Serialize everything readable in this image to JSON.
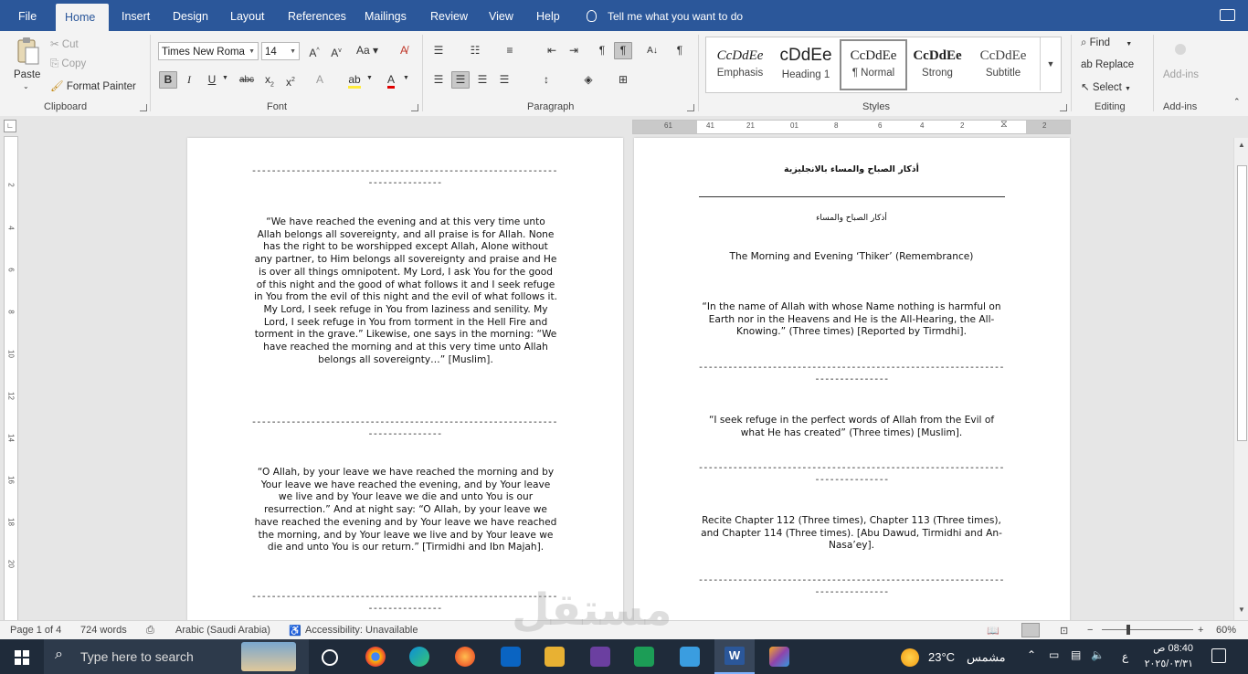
{
  "tabs": [
    "File",
    "Home",
    "Insert",
    "Design",
    "Layout",
    "References",
    "Mailings",
    "Review",
    "View",
    "Help"
  ],
  "active_tab": "Home",
  "tell_me": "Tell me what you want to do",
  "clipboard": {
    "paste": "Paste",
    "cut": "Cut",
    "copy": "Copy",
    "format_painter": "Format Painter",
    "label": "Clipboard"
  },
  "font": {
    "name": "Times New Roma",
    "size": "14",
    "label": "Font"
  },
  "paragraph": {
    "label": "Paragraph"
  },
  "styles": {
    "label": "Styles",
    "items": [
      {
        "sample": "CcDdEe",
        "name": "Emphasis"
      },
      {
        "sample": "cDdEe",
        "name": "Heading 1"
      },
      {
        "sample": "CcDdEe",
        "name": "¶ Normal"
      },
      {
        "sample": "CcDdEe",
        "name": "Strong"
      },
      {
        "sample": "CcDdEe",
        "name": "Subtitle"
      }
    ]
  },
  "editing": {
    "find": "Find",
    "replace": "Replace",
    "select": "Select",
    "label": "Editing"
  },
  "addins": {
    "button": "Add-ins",
    "label": "Add-ins"
  },
  "ruler_h": [
    "61",
    "41",
    "21",
    "01",
    "8",
    "6",
    "4",
    "2",
    "2"
  ],
  "ruler_v": [
    "2",
    "4",
    "6",
    "8",
    "10",
    "12",
    "14",
    "16",
    "18",
    "20"
  ],
  "page_left": {
    "sep1a": "------------------------------------------------------------------------------",
    "sep1b": "---------------",
    "para1": "“We have reached the evening and at this very time unto Allah belongs all sovereignty, and all praise is for Allah. None has the right to be worshipped except Allah, Alone without any partner, to Him belongs all sovereignty and praise and He is over all things omnipotent. My Lord, I ask You for the good of this night and the good of what follows it and I seek refuge in You from the evil of this night and the evil of what follows it. My Lord, I seek refuge in You from laziness and senility. My Lord, I seek refuge in You from torment in the Hell Fire and torment in the grave.” Likewise, one says in the morning: “We have reached the morning and at this very time unto Allah belongs all sovereignty…” [Muslim].",
    "sep2a": "------------------------------------------------------------------------------",
    "sep2b": "---------------",
    "para2": "“O Allah, by your leave we have reached the morning and by Your leave we have reached the evening, and by Your leave we live and by Your leave we die and unto You is our resurrection.” And at night say: “O Allah, by your leave we have reached the evening and by Your leave we have reached the morning, and by Your leave we live and by Your leave we die and unto You is our return.” [Tirmidhi and Ibn Majah].",
    "sep3a": "------------------------------------------------------------------------------",
    "sep3b": "---------------"
  },
  "page_right": {
    "arabic_title": "أذكار الصباح والمساء بالانجليزية",
    "arabic_sub": "أذكار الصباح والمساء",
    "title": "The Morning and Evening ‘Thiker’ (Remembrance)",
    "para1": "“In the name of Allah with whose Name nothing is harmful on Earth nor in the Heavens and He is the All-Hearing, the All-Knowing.” (Three times) [Reported by Tirmdhi].",
    "sep1a": "------------------------------------------------------------------------------",
    "sep1b": "---------------",
    "para2": "“I seek refuge in the perfect words of Allah from the Evil of what He has created” (Three times) [Muslim].",
    "sep2a": "------------------------------------------------------------------------------",
    "sep2b": "---------------",
    "para3": "Recite Chapter 112 (Three times), Chapter 113 (Three times), and Chapter 114 (Three times). [Abu Dawud, Tirmidhi and An-Nasa’ey].",
    "sep3a": "------------------------------------------------------------------------------",
    "sep3b": "---------------"
  },
  "status": {
    "page": "Page 1 of 4",
    "words": "724 words",
    "language": "Arabic (Saudi Arabia)",
    "accessibility": "Accessibility: Unavailable",
    "zoom": "60%"
  },
  "taskbar": {
    "search_placeholder": "Type here to search",
    "temperature": "23°C",
    "weather_label": "مشمس",
    "time": "08:40 ص",
    "date": "٢٠٢٥/٠٣/٣١",
    "lang": "ع"
  },
  "watermark": "مستقل"
}
